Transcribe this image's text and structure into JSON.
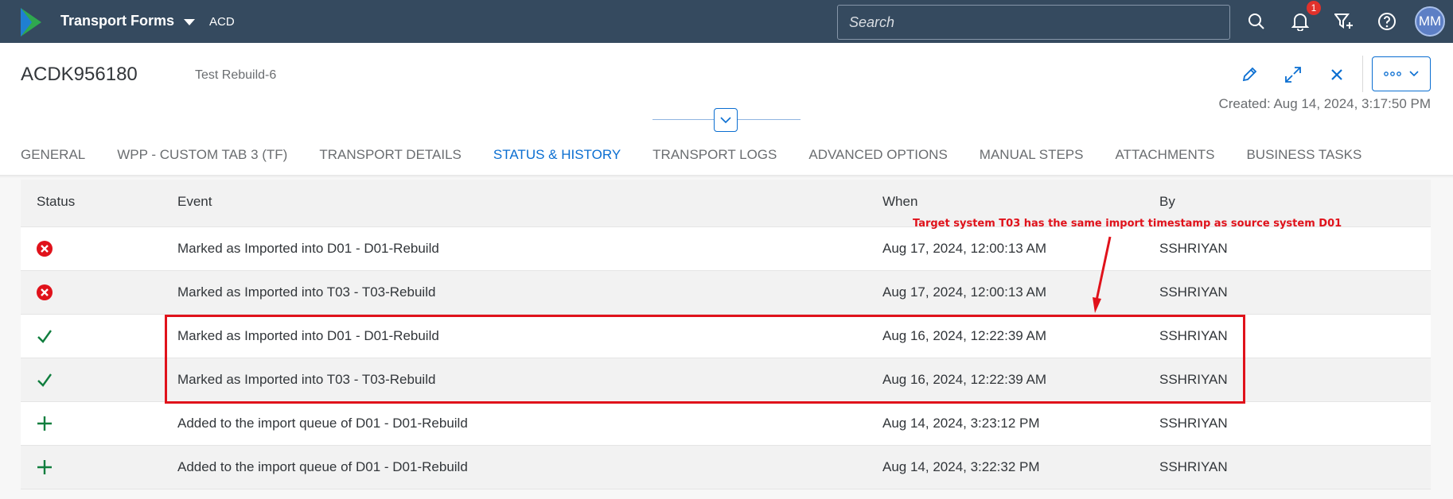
{
  "shell": {
    "app_title": "Transport Forms",
    "system": "ACD",
    "search_placeholder": "Search",
    "notification_count": "1",
    "avatar_initials": "MM"
  },
  "header": {
    "object_id": "ACDK956180",
    "description": "Test Rebuild-6",
    "created": "Created: Aug 14, 2024, 3:17:50 PM"
  },
  "tabs": [
    {
      "label": "GENERAL",
      "active": false
    },
    {
      "label": "WPP - CUSTOM TAB 3 (TF)",
      "active": false
    },
    {
      "label": "TRANSPORT DETAILS",
      "active": false
    },
    {
      "label": "STATUS & HISTORY",
      "active": true
    },
    {
      "label": "TRANSPORT LOGS",
      "active": false
    },
    {
      "label": "ADVANCED OPTIONS",
      "active": false
    },
    {
      "label": "MANUAL STEPS",
      "active": false
    },
    {
      "label": "ATTACHMENTS",
      "active": false
    },
    {
      "label": "BUSINESS TASKS",
      "active": false
    }
  ],
  "table": {
    "columns": {
      "status": "Status",
      "event": "Event",
      "when": "When",
      "by": "By"
    },
    "rows": [
      {
        "status_icon": "error-icon",
        "event": "Marked as Imported into D01 - D01-Rebuild",
        "when": "Aug 17, 2024, 12:00:13 AM",
        "by": "SSHRIYAN"
      },
      {
        "status_icon": "error-icon",
        "event": "Marked as Imported into T03 - T03-Rebuild",
        "when": "Aug 17, 2024, 12:00:13 AM",
        "by": "SSHRIYAN"
      },
      {
        "status_icon": "checkmark-icon",
        "event": "Marked as Imported into D01 - D01-Rebuild",
        "when": "Aug 16, 2024, 12:22:39 AM",
        "by": "SSHRIYAN"
      },
      {
        "status_icon": "checkmark-icon",
        "event": "Marked as Imported into T03 - T03-Rebuild",
        "when": "Aug 16, 2024, 12:22:39 AM",
        "by": "SSHRIYAN"
      },
      {
        "status_icon": "plus-icon",
        "event": "Added to the import queue of D01 - D01-Rebuild",
        "when": "Aug 14, 2024, 3:23:12 PM",
        "by": "SSHRIYAN"
      },
      {
        "status_icon": "plus-icon",
        "event": "Added to the import queue of D01 - D01-Rebuild",
        "when": "Aug 14, 2024, 3:22:32 PM",
        "by": "SSHRIYAN"
      }
    ]
  },
  "annotation": {
    "text": "Target system T03 has the same import timestamp as source system D01",
    "color": "#e0121b"
  },
  "colors": {
    "shell_bg": "#354a5f",
    "accent": "#0a6ed1",
    "error": "#e0121b",
    "success": "#107e3e"
  }
}
